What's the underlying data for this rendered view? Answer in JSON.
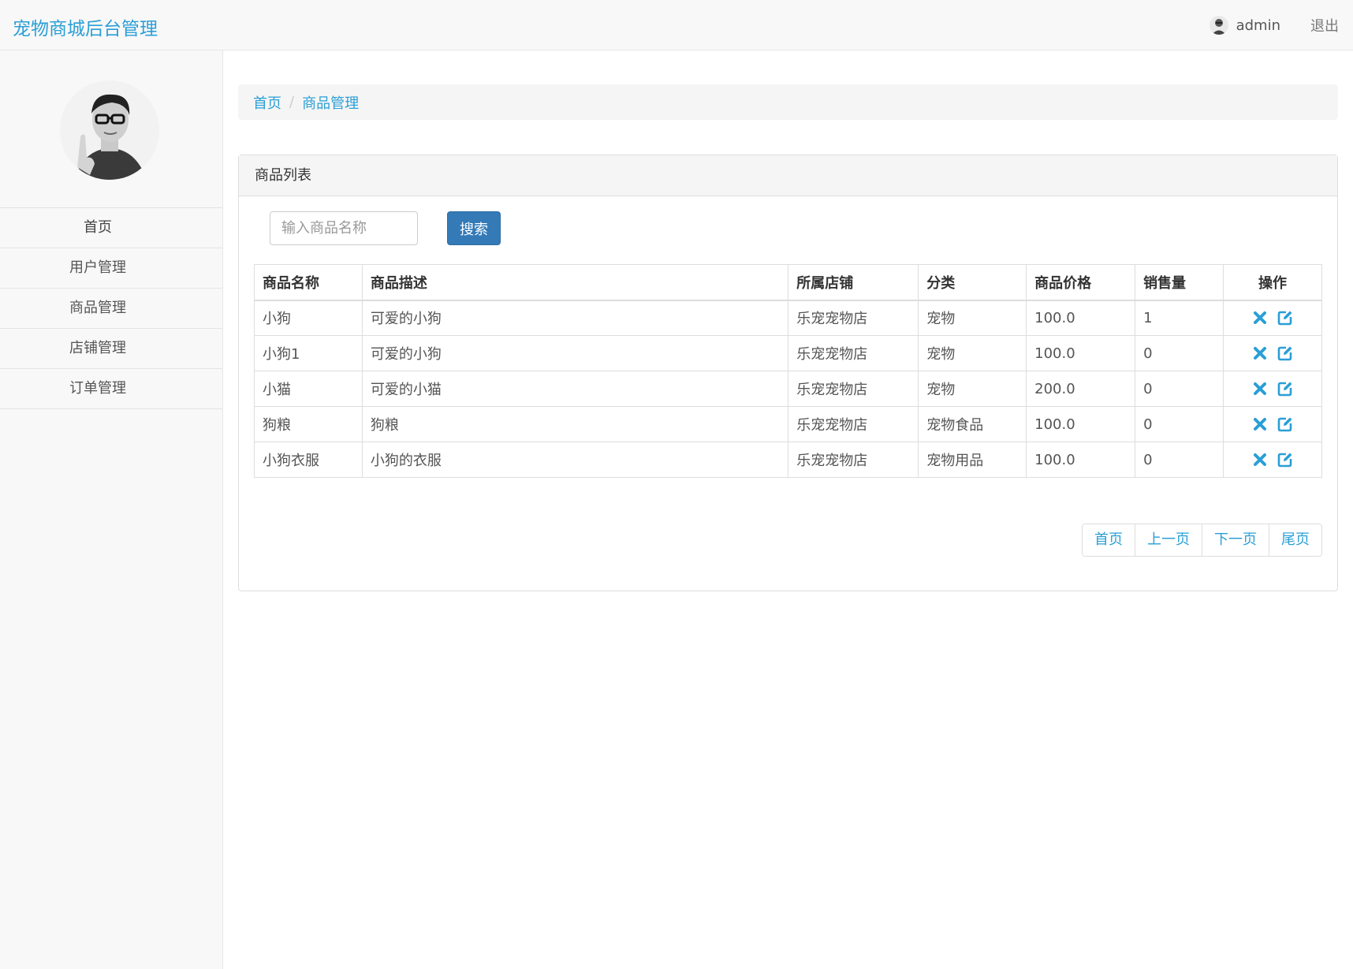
{
  "header": {
    "brand": "宠物商城后台管理",
    "username": "admin",
    "logout": "退出"
  },
  "sidebar": {
    "items": [
      {
        "label": "首页"
      },
      {
        "label": "用户管理"
      },
      {
        "label": "商品管理"
      },
      {
        "label": "店铺管理"
      },
      {
        "label": "订单管理"
      }
    ]
  },
  "breadcrumb": {
    "home": "首页",
    "separator": "/",
    "current": "商品管理"
  },
  "panel": {
    "title": "商品列表",
    "search_placeholder": "输入商品名称",
    "search_button": "搜索"
  },
  "table": {
    "headers": [
      "商品名称",
      "商品描述",
      "所属店铺",
      "分类",
      "商品价格",
      "销售量",
      "操作"
    ],
    "rows": [
      [
        "小狗",
        "可爱的小狗",
        "乐宠宠物店",
        "宠物",
        "100.0",
        "1"
      ],
      [
        "小狗1",
        "可爱的小狗",
        "乐宠宠物店",
        "宠物",
        "100.0",
        "0"
      ],
      [
        "小猫",
        "可爱的小猫",
        "乐宠宠物店",
        "宠物",
        "200.0",
        "0"
      ],
      [
        "狗粮",
        "狗粮",
        "乐宠宠物店",
        "宠物食品",
        "100.0",
        "0"
      ],
      [
        "小狗衣服",
        "小狗的衣服",
        "乐宠宠物店",
        "宠物用品",
        "100.0",
        "0"
      ]
    ]
  },
  "pagination": {
    "first": "首页",
    "prev": "上一页",
    "next": "下一页",
    "last": "尾页"
  },
  "colors": {
    "brand": "#2a9fd6",
    "primary_button": "#337ab7",
    "action_icon": "#2a9fd6"
  },
  "icons": {
    "delete": "times-icon",
    "edit": "edit-icon"
  }
}
